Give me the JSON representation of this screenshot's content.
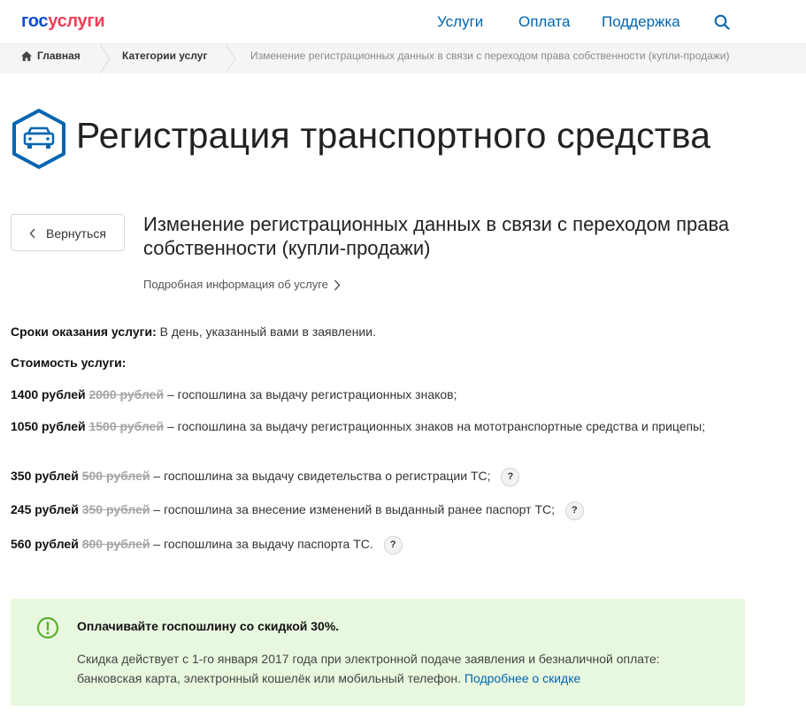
{
  "header": {
    "logo_part1": "гос",
    "logo_part2": "услуги",
    "nav": [
      "Услуги",
      "Оплата",
      "Поддержка"
    ],
    "search_icon": "search-icon"
  },
  "breadcrumb": {
    "home": "Главная",
    "categories": "Категории услуг",
    "current": "Изменение регистрационных данных в связи с переходом права собственности (купли-продажи)"
  },
  "page": {
    "title": "Регистрация транспортного средства",
    "title_icon": "car-icon"
  },
  "back_button": {
    "label": "Вернуться"
  },
  "service": {
    "title": "Изменение регистрационных данных в связи с переходом права собственности (купли-продажи)",
    "details_link": "Подробная информация об услуге"
  },
  "terms": {
    "label": "Сроки оказания услуги:",
    "value": "В день, указанный вами в заявлении."
  },
  "cost": {
    "label": "Стоимость услуги:",
    "items": [
      {
        "price": "1400 рублей",
        "old_price": "2000 рублей",
        "desc": "– госпошлина за выдачу регистрационных знаков;",
        "has_help": false
      },
      {
        "price": "1050 рублей",
        "old_price": "1500 рублей",
        "desc": "– госпошлина за выдачу регистрационных знаков на мототранспортные средства и прицепы;",
        "has_help": false
      },
      {
        "price": "350 рублей",
        "old_price": "500 рублей",
        "desc": "– госпошлина за выдачу свидетельства о регистрации ТС;",
        "has_help": true
      },
      {
        "price": "245 рублей",
        "old_price": "350 рублей",
        "desc": "– госпошлина за внесение изменений в выданный ранее паспорт ТС;",
        "has_help": true
      },
      {
        "price": "560 рублей",
        "old_price": "800 рублей",
        "desc": "– госпошлина за выдачу паспорта ТС.",
        "has_help": true
      }
    ],
    "help_glyph": "?"
  },
  "discount": {
    "title": "Оплачивайте госпошлину со скидкой 30%.",
    "text": "Скидка действует с 1-го января 2017 года при электронной подаче заявления и безналичной оплате: банковская карта, электронный кошелёк или мобильный телефон.",
    "link": "Подробнее о скидке",
    "icon": "exclamation-circle-icon"
  },
  "colors": {
    "brand_blue": "#0d4cd3",
    "brand_red": "#ee3f58",
    "link_blue": "#0065b1",
    "discount_bg": "#e8f8df",
    "discount_icon": "#5bb12f"
  }
}
